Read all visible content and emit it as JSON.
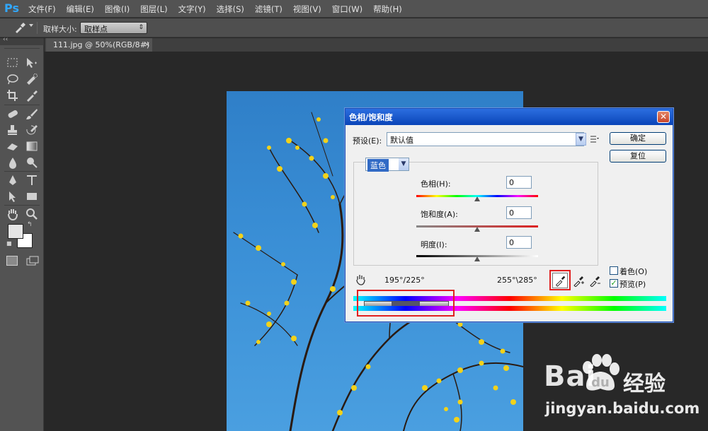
{
  "app": {
    "logo": "Ps",
    "menu": [
      "文件(F)",
      "编辑(E)",
      "图像(I)",
      "图层(L)",
      "文字(Y)",
      "选择(S)",
      "滤镜(T)",
      "视图(V)",
      "窗口(W)",
      "帮助(H)"
    ]
  },
  "options_bar": {
    "sample_size_label": "取样大小:",
    "sample_size_value": "取样点"
  },
  "document": {
    "tab_title": "111.jpg @ 50%(RGB/8#)",
    "close_glyph": "×"
  },
  "dialog": {
    "title": "色相/饱和度",
    "close_glyph": "✕",
    "preset_label": "预设(E):",
    "preset_value": "默认值",
    "ok_label": "确定",
    "reset_label": "复位",
    "channel_value": "蓝色",
    "sliders": [
      {
        "label": "色相(H):",
        "value": "0",
        "level": 0.5
      },
      {
        "label": "饱和度(A):",
        "value": "0",
        "level": 0.5
      },
      {
        "label": "明度(I):",
        "value": "0",
        "level": 0.5
      }
    ],
    "range_left": "195°/225°",
    "range_right": "255°\\285°",
    "colorize_label": "着色(O)",
    "colorize_checked": false,
    "preview_label": "预览(P)",
    "preview_checked": true
  },
  "watermark": {
    "brand": "Bai  经验",
    "brand_left": "Bai",
    "brand_right": "经验",
    "url": "jingyan.baidu.com"
  },
  "colors": {
    "highlight": "#e02020",
    "accent": "#2c6fe0"
  }
}
